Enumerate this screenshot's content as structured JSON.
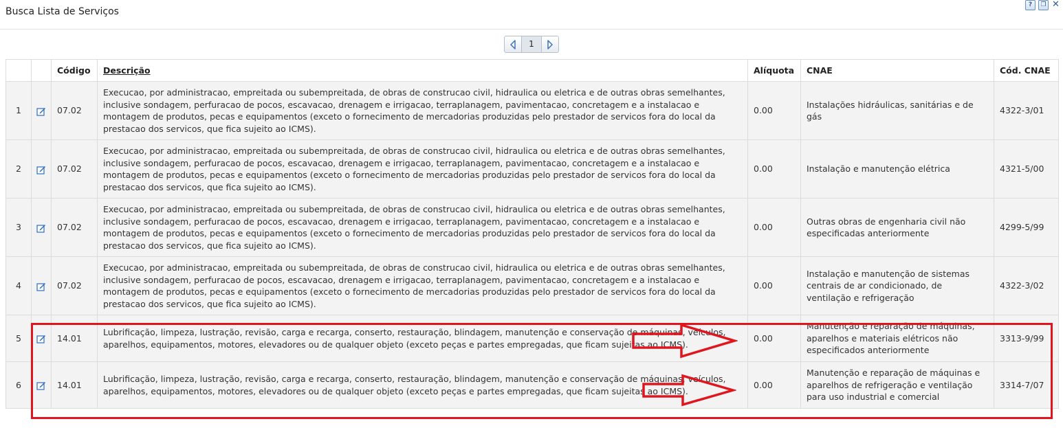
{
  "window": {
    "title": "Busca Lista de Serviços",
    "icons": [
      "help-icon",
      "restore-icon",
      "close-icon"
    ]
  },
  "pager": {
    "current_page": "1",
    "prev_icon": "chevron-left-icon",
    "next_icon": "chevron-right-icon"
  },
  "table": {
    "headers": {
      "num": "",
      "edit": "",
      "codigo": "Código",
      "descricao": "Descrição",
      "aliquota": "Alíquota",
      "cnae": "CNAE",
      "cod_cnae": "Cód. CNAE"
    },
    "rows": [
      {
        "num": "1",
        "codigo": "07.02",
        "descricao": "Execucao, por administracao, empreitada ou subempreitada, de obras de construcao civil, hidraulica ou eletrica e de outras obras semelhantes, inclusive sondagem, perfuracao de pocos, escavacao, drenagem e irrigacao, terraplanagem, pavimentacao, concretagem e a instalacao e montagem de produtos, pecas e equipamentos (exceto o fornecimento de mercadorias produzidas pelo prestador de servicos fora do local da prestacao dos servicos, que fica sujeito ao ICMS).",
        "aliquota": "0.00",
        "cnae": "Instalações hidráulicas, sanitárias e de gás",
        "cod_cnae": "4322-3/01"
      },
      {
        "num": "2",
        "codigo": "07.02",
        "descricao": "Execucao, por administracao, empreitada ou subempreitada, de obras de construcao civil, hidraulica ou eletrica e de outras obras semelhantes, inclusive sondagem, perfuracao de pocos, escavacao, drenagem e irrigacao, terraplanagem, pavimentacao, concretagem e a instalacao e montagem de produtos, pecas e equipamentos (exceto o fornecimento de mercadorias produzidas pelo prestador de servicos fora do local da prestacao dos servicos, que fica sujeito ao ICMS).",
        "aliquota": "0.00",
        "cnae": "Instalação e manutenção elétrica",
        "cod_cnae": "4321-5/00"
      },
      {
        "num": "3",
        "codigo": "07.02",
        "descricao": "Execucao, por administracao, empreitada ou subempreitada, de obras de construcao civil, hidraulica ou eletrica e de outras obras semelhantes, inclusive sondagem, perfuracao de pocos, escavacao, drenagem e irrigacao, terraplanagem, pavimentacao, concretagem e a instalacao e montagem de produtos, pecas e equipamentos (exceto o fornecimento de mercadorias produzidas pelo prestador de servicos fora do local da prestacao dos servicos, que fica sujeito ao ICMS).",
        "aliquota": "0.00",
        "cnae": "Outras obras de engenharia civil não especificadas anteriormente",
        "cod_cnae": "4299-5/99"
      },
      {
        "num": "4",
        "codigo": "07.02",
        "descricao": "Execucao, por administracao, empreitada ou subempreitada, de obras de construcao civil, hidraulica ou eletrica e de outras obras semelhantes, inclusive sondagem, perfuracao de pocos, escavacao, drenagem e irrigacao, terraplanagem, pavimentacao, concretagem e a instalacao e montagem de produtos, pecas e equipamentos (exceto o fornecimento de mercadorias produzidas pelo prestador de servicos fora do local da prestacao dos servicos, que fica sujeito ao ICMS).",
        "aliquota": "0.00",
        "cnae": "Instalação e manutenção de sistemas centrais de ar condicionado, de ventilação e refrigeração",
        "cod_cnae": "4322-3/02"
      },
      {
        "num": "5",
        "codigo": "14.01",
        "descricao": "Lubrificação, limpeza, lustração, revisão, carga e recarga, conserto, restauração, blindagem, manutenção e conservação de máquinas, veículos, aparelhos, equipamentos, motores, elevadores ou de qualquer objeto (exceto peças e partes empregadas, que ficam sujeitas ao ICMS).",
        "aliquota": "0.00",
        "cnae": "Manutenção e reparação de máquinas, aparelhos e materiais elétricos não especificados anteriormente",
        "cod_cnae": "3313-9/99"
      },
      {
        "num": "6",
        "codigo": "14.01",
        "descricao": "Lubrificação, limpeza, lustração, revisão, carga e recarga, conserto, restauração, blindagem, manutenção e conservação de máquinas, veículos, aparelhos, equipamentos, motores, elevadores ou de qualquer objeto (exceto peças e partes empregadas, que ficam sujeitas ao ICMS).",
        "aliquota": "0.00",
        "cnae": "Manutenção e reparação de máquinas e aparelhos de refrigeração e ventilação para uso industrial e comercial",
        "cod_cnae": "3314-7/07"
      }
    ]
  },
  "annotations": {
    "highlight_color": "#e0161e",
    "highlighted_rows": [
      5,
      6
    ]
  },
  "colors": {
    "row_background": "#f3f3f3",
    "border": "#dcdcdc",
    "link_icon": "#2b6cc4"
  }
}
